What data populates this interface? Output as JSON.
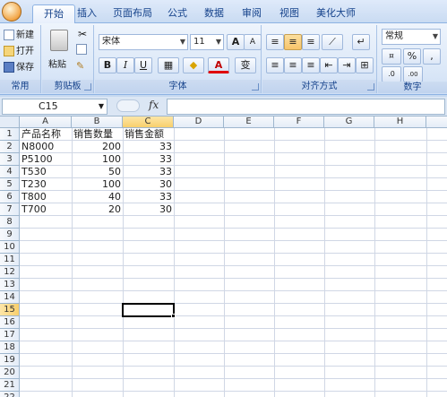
{
  "ribbon": {
    "tabs": [
      "开始",
      "插入",
      "页面布局",
      "公式",
      "数据",
      "审阅",
      "视图",
      "美化大师"
    ],
    "active_tab": "开始",
    "groups": {
      "common": {
        "label": "常用",
        "new": "新建",
        "open": "打开",
        "save": "保存"
      },
      "clipboard": {
        "label": "剪贴板",
        "paste": "粘贴"
      },
      "font": {
        "label": "字体",
        "font_name": "宋体",
        "font_size": "11",
        "grow": "A",
        "shrink": "A",
        "bold": "B",
        "italic": "I",
        "underline": "U",
        "font_color": "A",
        "phonetic": "变"
      },
      "alignment": {
        "label": "对齐方式"
      },
      "number": {
        "label": "数字",
        "format": "常规",
        "percent": "%",
        "comma": ",",
        "inc_decimal": ".0",
        "dec_decimal": ".00"
      }
    }
  },
  "formula_bar": {
    "name_box": "C15",
    "fx": "fx",
    "formula": ""
  },
  "sheet": {
    "columns": [
      "A",
      "B",
      "C",
      "D",
      "E",
      "F",
      "G",
      "H"
    ],
    "rows": [
      "1",
      "2",
      "3",
      "4",
      "5",
      "6",
      "7",
      "8",
      "9",
      "10",
      "11",
      "12",
      "13",
      "14",
      "15",
      "16",
      "17",
      "18",
      "19",
      "20",
      "21",
      "22"
    ],
    "selected_cell": "C15",
    "header": {
      "a": "产品名称",
      "b": "销售数量",
      "c": "销售金额"
    },
    "data": [
      {
        "a": "N8000",
        "b": "200",
        "c": "33"
      },
      {
        "a": "P5100",
        "b": "100",
        "c": "33"
      },
      {
        "a": "T530",
        "b": "50",
        "c": "33"
      },
      {
        "a": "T230",
        "b": "100",
        "c": "30"
      },
      {
        "a": "T800",
        "b": "40",
        "c": "33"
      },
      {
        "a": "T700",
        "b": "20",
        "c": "30"
      }
    ]
  },
  "colors": {
    "accent": "#15428b",
    "selection_header": "#f8cf6c"
  }
}
